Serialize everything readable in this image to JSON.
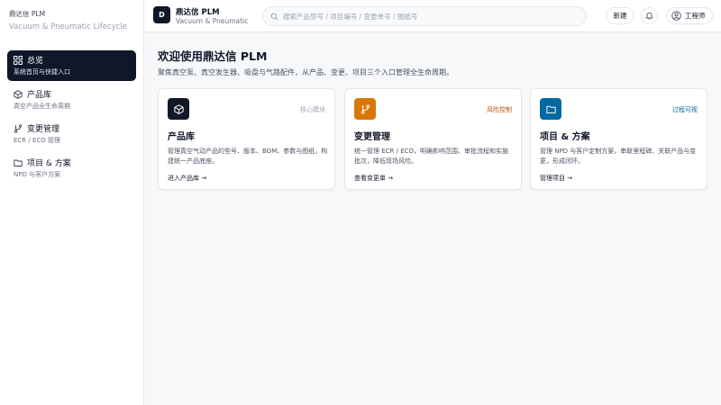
{
  "sidebar": {
    "brand_name": "鼎达信 PLM",
    "brand_tagline": "Vacuum & Pneumatic Lifecycle",
    "items": [
      {
        "label": "总览",
        "desc": "系统首页与快捷入口",
        "icon": "dashboard-icon",
        "active": true
      },
      {
        "label": "产品库",
        "desc": "真空产品全生命周期",
        "icon": "package-icon",
        "active": false
      },
      {
        "label": "变更管理",
        "desc": "ECR / ECO 管理",
        "icon": "git-branch-icon",
        "active": false
      },
      {
        "label": "项目 & 方案",
        "desc": "NPD 与客户方案",
        "icon": "folder-icon",
        "active": false
      }
    ]
  },
  "topbar": {
    "logo_letter": "D",
    "app_name": "鼎达信 PLM",
    "app_sub": "Vacuum & Pneumatic",
    "search_placeholder": "搜索产品型号 / 项目编号 / 变更单号 / 图纸号",
    "new_label": "新建",
    "user_label": "工程师"
  },
  "main": {
    "title": "欢迎使用鼎达信 PLM",
    "subtitle": "聚焦真空泵、真空发生器、吸盘与气路配件，从产品、变更、项目三个入口管理全生命周期。",
    "cards": [
      {
        "title": "产品库",
        "tag": "核心模块",
        "desc": "管理真空气动产品的型号、版本、BOM、参数与图纸，构建统一产品底座。",
        "link": "进入产品库 →",
        "icon": "package-icon",
        "icon_bg": "#111827",
        "tag_color": "#9ca3af"
      },
      {
        "title": "变更管理",
        "tag": "风险控制",
        "desc": "统一管理 ECR / ECO，明确影响范围、审批流程和实施批次，降低现场风险。",
        "link": "查看变更单 →",
        "icon": "git-branch-icon",
        "icon_bg": "#d97706",
        "tag_color": "#b45309"
      },
      {
        "title": "项目 & 方案",
        "tag": "过程可视",
        "desc": "管理 NPD 与客户定制方案，串联里程碑、关联产品与变更，形成闭环。",
        "link": "管理项目 →",
        "icon": "folder-icon",
        "icon_bg": "#0369a1",
        "tag_color": "#0369a1"
      }
    ]
  }
}
